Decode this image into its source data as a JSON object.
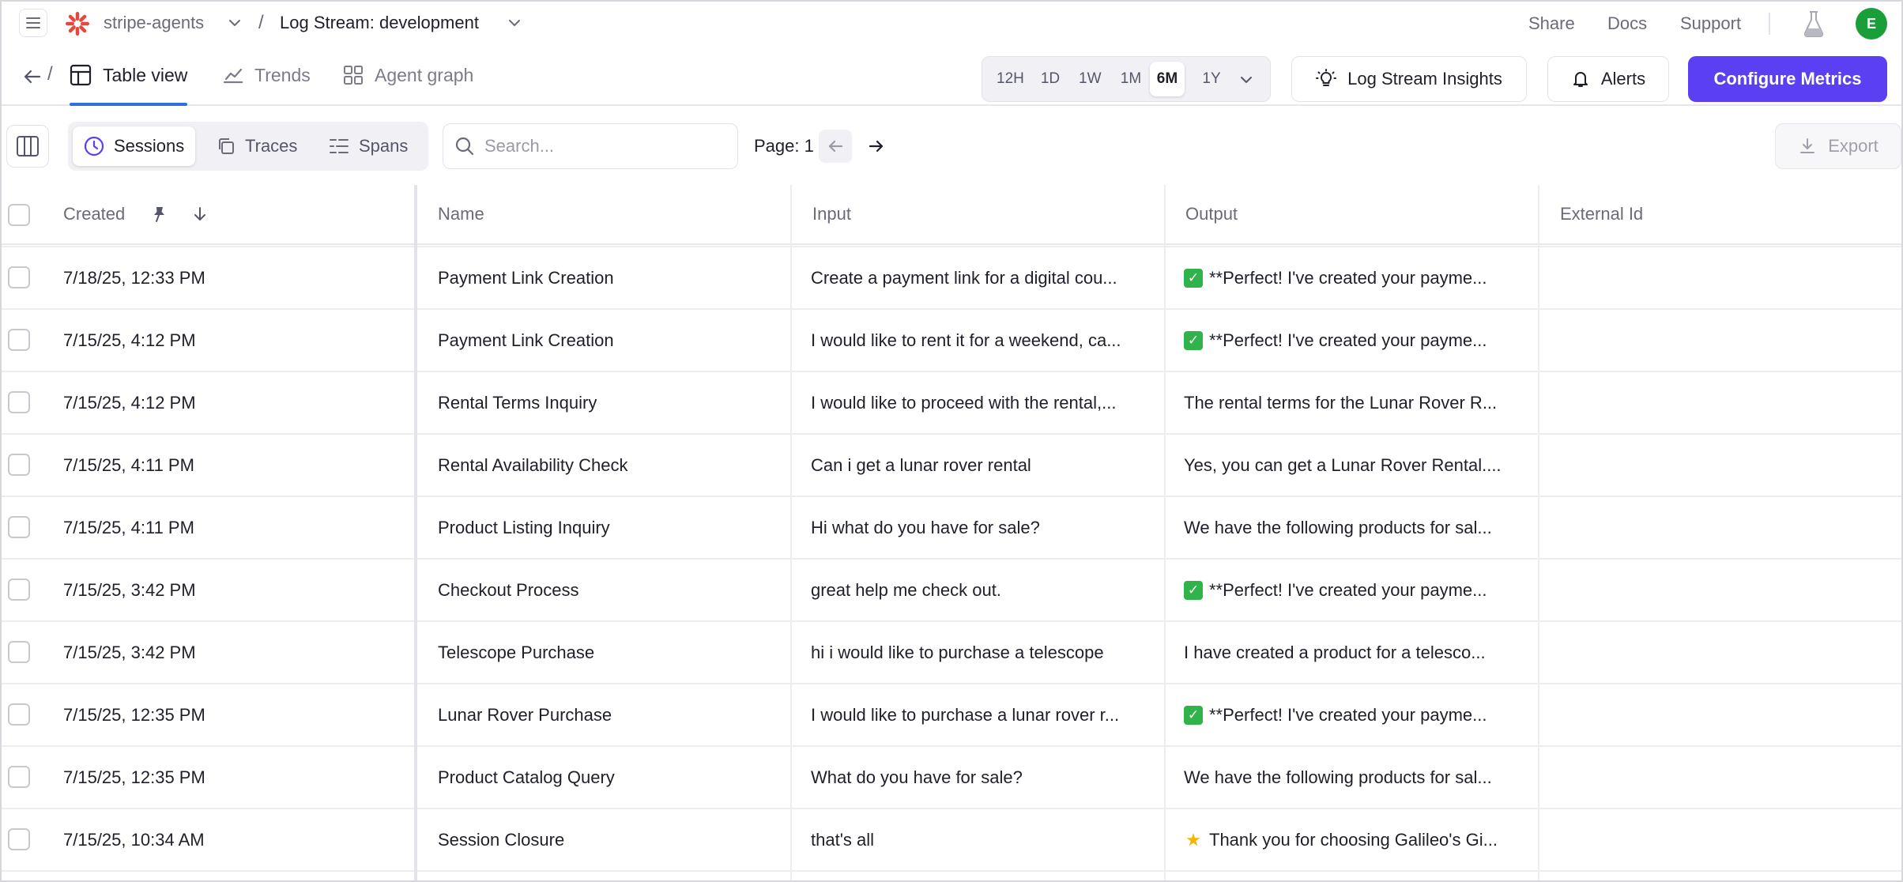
{
  "topbar": {
    "org_name": "stripe-agents",
    "project_name": "Log Stream: development",
    "links": [
      "Share",
      "Docs",
      "Support"
    ],
    "avatar_initial": "E",
    "brand_color": "#e8453c",
    "avatar_color": "#1a9e3a"
  },
  "viewbar": {
    "tabs": [
      {
        "label": "Table view",
        "icon": "table-icon",
        "active": true
      },
      {
        "label": "Trends",
        "icon": "trend-line-icon",
        "active": false
      },
      {
        "label": "Agent graph",
        "icon": "grid-icon",
        "active": false
      }
    ],
    "ranges": [
      "12H",
      "1D",
      "1W",
      "1M",
      "6M",
      "1Y"
    ],
    "active_range": "6M",
    "insights_label": "Log Stream Insights",
    "alerts_label": "Alerts",
    "configure_label": "Configure Metrics",
    "primary_color": "#5b3ff2"
  },
  "toolbar": {
    "segments": [
      {
        "label": "Sessions",
        "icon": "clock-icon",
        "active": true
      },
      {
        "label": "Traces",
        "icon": "copy-icon",
        "active": false
      },
      {
        "label": "Spans",
        "icon": "list-icon",
        "active": false
      }
    ],
    "search_placeholder": "Search...",
    "page_label": "Page: 1",
    "export_label": "Export"
  },
  "table": {
    "columns": [
      "Created",
      "Name",
      "Input",
      "Output",
      "External Id"
    ],
    "rows": [
      {
        "created": "7/18/25, 12:33 PM",
        "name": "Payment Link Creation",
        "input": "Create a payment link for a digital cou...",
        "output_icon": "check",
        "output": "**Perfect! I've created your payme...",
        "external_id": ""
      },
      {
        "created": "7/15/25, 4:12 PM",
        "name": "Payment Link Creation",
        "input": "I would like to rent it for a weekend, ca...",
        "output_icon": "check",
        "output": "**Perfect! I've created your payme...",
        "external_id": ""
      },
      {
        "created": "7/15/25, 4:12 PM",
        "name": "Rental Terms Inquiry",
        "input": "I would like to proceed with the rental,...",
        "output_icon": "",
        "output": "The rental terms for the Lunar Rover R...",
        "external_id": ""
      },
      {
        "created": "7/15/25, 4:11 PM",
        "name": "Rental Availability Check",
        "input": "Can i get a lunar rover rental",
        "output_icon": "",
        "output": "Yes, you can get a Lunar Rover Rental....",
        "external_id": ""
      },
      {
        "created": "7/15/25, 4:11 PM",
        "name": "Product Listing Inquiry",
        "input": "Hi what do you have for sale?",
        "output_icon": "",
        "output": "We have the following products for sal...",
        "external_id": ""
      },
      {
        "created": "7/15/25, 3:42 PM",
        "name": "Checkout Process",
        "input": "great help me check out.",
        "output_icon": "check",
        "output": "**Perfect! I've created your payme...",
        "external_id": ""
      },
      {
        "created": "7/15/25, 3:42 PM",
        "name": "Telescope Purchase",
        "input": "hi i would like to purchase a telescope",
        "output_icon": "",
        "output": "I have created a product for a telesco...",
        "external_id": ""
      },
      {
        "created": "7/15/25, 12:35 PM",
        "name": "Lunar Rover Purchase",
        "input": "I would like to purchase a lunar rover r...",
        "output_icon": "check",
        "output": "**Perfect! I've created your payme...",
        "external_id": ""
      },
      {
        "created": "7/15/25, 12:35 PM",
        "name": "Product Catalog Query",
        "input": "What do you have for sale?",
        "output_icon": "",
        "output": "We have the following products for sal...",
        "external_id": ""
      },
      {
        "created": "7/15/25, 10:34 AM",
        "name": "Session Closure",
        "input": "that's all",
        "output_icon": "star",
        "output": "Thank you for choosing Galileo's Gi...",
        "external_id": ""
      }
    ]
  }
}
